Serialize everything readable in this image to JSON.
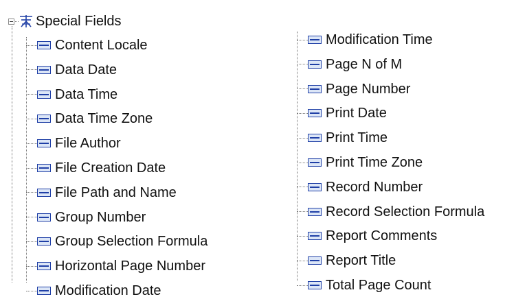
{
  "tree": {
    "root": {
      "label": "Special Fields",
      "icon": "special-fields-icon",
      "expander": "minus"
    },
    "columns": [
      {
        "items": [
          {
            "label": "Content Locale",
            "icon": "field-icon"
          },
          {
            "label": "Data Date",
            "icon": "field-icon"
          },
          {
            "label": "Data Time",
            "icon": "field-icon"
          },
          {
            "label": "Data Time Zone",
            "icon": "field-icon"
          },
          {
            "label": "File Author",
            "icon": "field-icon"
          },
          {
            "label": "File Creation Date",
            "icon": "field-icon"
          },
          {
            "label": "File Path and Name",
            "icon": "field-icon"
          },
          {
            "label": "Group Number",
            "icon": "field-icon"
          },
          {
            "label": "Group Selection Formula",
            "icon": "field-icon"
          },
          {
            "label": "Horizontal Page Number",
            "icon": "field-icon"
          },
          {
            "label": "Modification Date",
            "icon": "field-icon"
          }
        ]
      },
      {
        "items": [
          {
            "label": "Modification Time",
            "icon": "field-icon"
          },
          {
            "label": "Page N of M",
            "icon": "field-icon"
          },
          {
            "label": "Page Number",
            "icon": "field-icon"
          },
          {
            "label": "Print Date",
            "icon": "field-icon"
          },
          {
            "label": "Print Time",
            "icon": "field-icon"
          },
          {
            "label": "Print Time Zone",
            "icon": "field-icon"
          },
          {
            "label": "Record Number",
            "icon": "field-icon"
          },
          {
            "label": "Record Selection Formula",
            "icon": "field-icon"
          },
          {
            "label": "Report Comments",
            "icon": "field-icon"
          },
          {
            "label": "Report Title",
            "icon": "field-icon"
          },
          {
            "label": "Total Page Count",
            "icon": "field-icon"
          }
        ]
      }
    ]
  },
  "colors": {
    "icon_blue": "#1f3fa6",
    "icon_fill": "#dce6f7",
    "text": "#111111",
    "tree_line": "#777777"
  }
}
